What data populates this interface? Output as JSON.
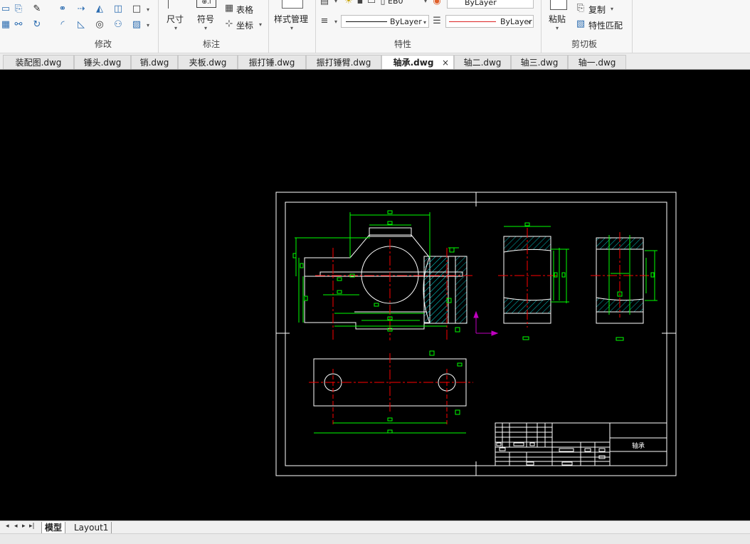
{
  "ribbon": {
    "modify": {
      "group_label": "修改"
    },
    "annotation": {
      "group_label": "标注",
      "dimension_label": "尺寸",
      "symbol_label": "符号",
      "table_label": "表格",
      "coordinate_label": "坐标"
    },
    "style": {
      "style_manage_label": "样式管理"
    },
    "properties": {
      "group_label": "特性",
      "layer_partial": "EB0",
      "color_value": "ByLayer",
      "linetype_value": "ByLayer",
      "lineweight_value": "ByLayer"
    },
    "clipboard": {
      "group_label": "剪切板",
      "paste_label": "粘贴",
      "copy_label": "复制",
      "match_label": "特性匹配"
    }
  },
  "tabs": [
    {
      "label": "装配图.dwg"
    },
    {
      "label": "锤头.dwg"
    },
    {
      "label": "销.dwg"
    },
    {
      "label": "夹板.dwg"
    },
    {
      "label": "振打锤.dwg"
    },
    {
      "label": "振打锤臂.dwg"
    },
    {
      "label": "轴承.dwg"
    },
    {
      "label": "轴二.dwg"
    },
    {
      "label": "轴三.dwg"
    },
    {
      "label": "轴一.dwg"
    }
  ],
  "active_tab_close": "×",
  "drawing": {
    "title_block_name": "轴承"
  },
  "layout_tabs": [
    {
      "label": "模型"
    },
    {
      "label": "Layout1"
    }
  ],
  "colors": {
    "canvas_bg": "#000000",
    "frame": "#ffffff",
    "dimension": "#00ff00",
    "centerline": "#ff0000",
    "hatch": "#00bfbf",
    "ucs": "#c000c0"
  }
}
